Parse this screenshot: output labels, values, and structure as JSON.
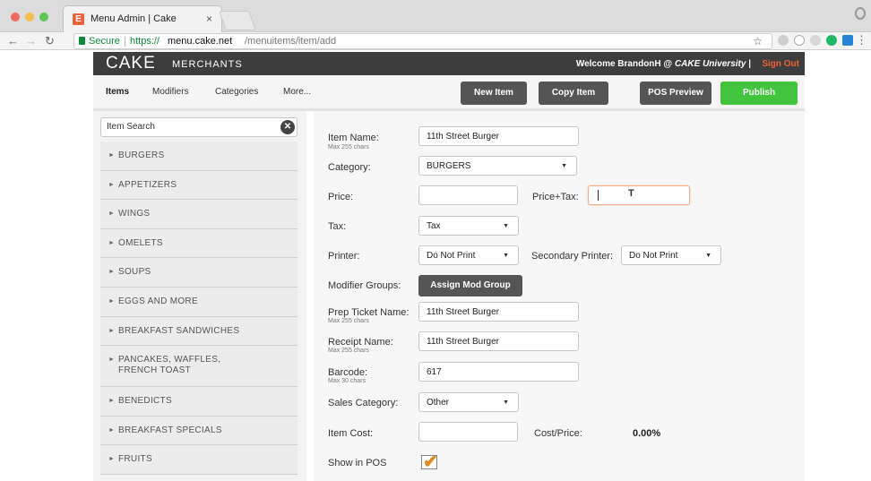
{
  "browser": {
    "tab_title": "Menu Admin | Cake",
    "tab_favicon": "E",
    "tab_close": "×",
    "secure_label": "Secure",
    "url_scheme": "https://",
    "url_host": "menu.cake.net",
    "url_path": "/menuitems/item/add"
  },
  "header": {
    "brand": "CAKE",
    "brand_sub": "MERCHANTS",
    "welcome_prefix": "Welcome BrandonH @ ",
    "welcome_org": "CAKE University",
    "welcome_sep": " | ",
    "signout": "Sign Out"
  },
  "subnav": {
    "links": [
      "Items",
      "Modifiers",
      "Categories",
      "More..."
    ],
    "new_item": "New Item",
    "copy_item": "Copy Item",
    "pos_preview": "POS Preview",
    "publish": "Publish"
  },
  "sidebar": {
    "search_value": "Item Search",
    "clear_glyph": "✕",
    "categories": [
      "BURGERS",
      "APPETIZERS",
      "WINGS",
      "OMELETS",
      "SOUPS",
      "EGGS AND MORE",
      "BREAKFAST SANDWICHES",
      "PANCAKES, WAFFLES, FRENCH TOAST",
      "BENEDICTS",
      "BREAKFAST SPECIALS",
      "FRUITS"
    ]
  },
  "form": {
    "item_name_label": "Item Name:",
    "item_name_sub": "Max 255 chars",
    "item_name_value": "11th Street Burger",
    "category_label": "Category:",
    "category_value": "BURGERS",
    "price_label": "Price:",
    "price_value": "",
    "price_tax_label": "Price+Tax:",
    "price_tax_value": "",
    "tax_label": "Tax:",
    "tax_value": "Tax",
    "printer_label": "Printer:",
    "printer_value": "Do Not Print",
    "secondary_printer_label": "Secondary Printer:",
    "secondary_printer_value": "Do Not Print",
    "modifier_groups_label": "Modifier Groups:",
    "assign_mod_group": "Assign Mod Group",
    "prep_ticket_label": "Prep Ticket Name:",
    "prep_ticket_sub": "Max 255 chars",
    "prep_ticket_value": "11th Street Burger",
    "receipt_name_label": "Receipt Name:",
    "receipt_name_sub": "Max 255 chars",
    "receipt_name_value": "11th Street Burger",
    "barcode_label": "Barcode:",
    "barcode_sub": "Max 30 chars",
    "barcode_value": "617",
    "sales_category_label": "Sales Category:",
    "sales_category_value": "Other",
    "item_cost_label": "Item Cost:",
    "item_cost_value": "",
    "cost_price_label": "Cost/Price:",
    "cost_price_value": "0.00%",
    "show_in_pos_label": "Show in POS",
    "show_in_pos_checked": true
  },
  "colors": {
    "brand_accent": "#e8643a",
    "header_bg": "#3d3d3d",
    "publish_green": "#42c43f",
    "dark_button": "#555555",
    "check_orange": "#e08a1e"
  },
  "icons": {
    "back": "arrow-left-icon",
    "forward": "arrow-right-icon",
    "reload": "reload-icon",
    "lock": "lock-icon",
    "star": "star-icon",
    "clear": "clear-icon",
    "caret": "chevron-down-icon",
    "checkmark": "checkmark-icon"
  }
}
